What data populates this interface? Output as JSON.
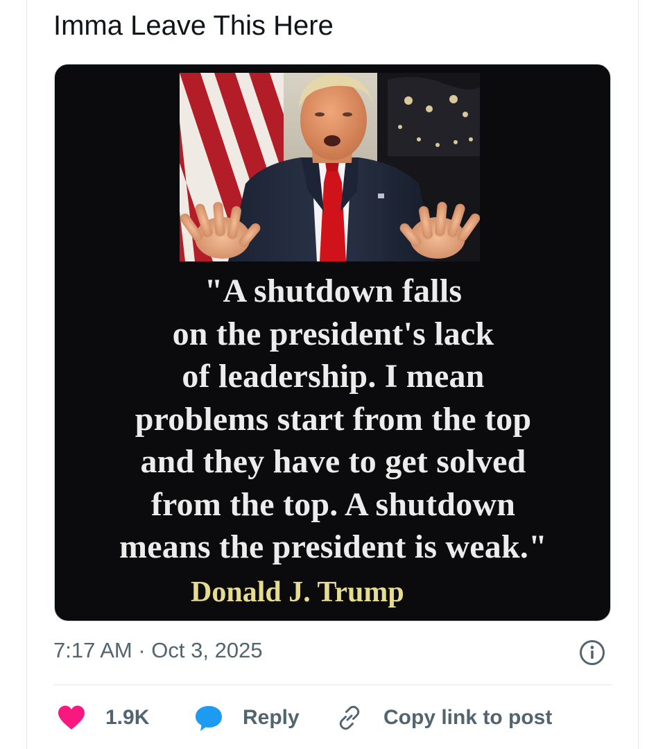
{
  "post": {
    "text": "Imma Leave This Here"
  },
  "media": {
    "quote_lines": [
      "\"A shutdown falls",
      "on the president's lack",
      "of leadership. I mean",
      "problems start from the top",
      "and they have to get solved",
      "from the top. A shutdown",
      "means the president is weak.\""
    ],
    "attribution": "Donald J. Trump",
    "photo_subject": "man-in-suit-speaking-photo",
    "colors": {
      "background": "#0b0b0d",
      "quote_text": "#ececec",
      "attribution_text": "#e5dc8f"
    }
  },
  "meta": {
    "timestamp": "7:17 AM · Oct 3, 2025",
    "info_icon": "info-icon"
  },
  "actions": {
    "like_count": "1.9K",
    "reply_label": "Reply",
    "copy_label": "Copy link to post",
    "like_icon": "heart-icon",
    "reply_icon": "speech-bubble-icon",
    "copy_icon": "link-icon",
    "like_color": "#f91880",
    "reply_color": "#1d9bf0"
  }
}
